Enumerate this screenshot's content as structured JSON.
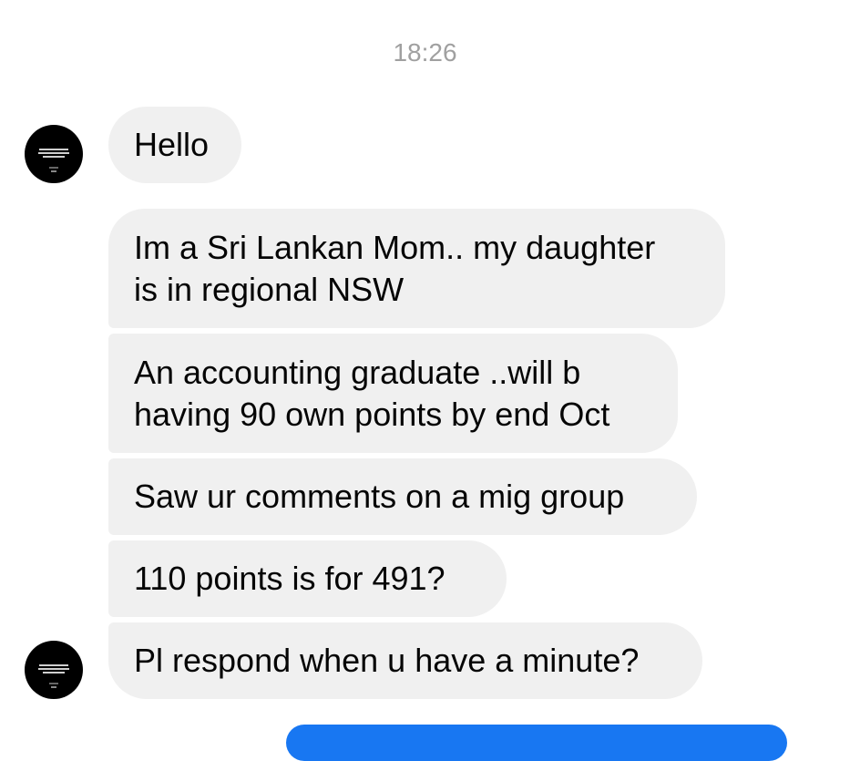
{
  "thread": {
    "timestamp": "18:26",
    "messages": [
      {
        "sender": "contact",
        "text": "Hello",
        "show_avatar": true
      },
      {
        "sender": "contact",
        "text": "Im a Sri Lankan Mom.. my daughter\nis in regional NSW",
        "show_avatar": false
      },
      {
        "sender": "contact",
        "text": "An accounting graduate ..will b\nhaving 90 own points by end Oct",
        "show_avatar": false
      },
      {
        "sender": "contact",
        "text": "Saw ur comments on a mig group",
        "show_avatar": false
      },
      {
        "sender": "contact",
        "text": "110 points is for 491?",
        "show_avatar": false
      },
      {
        "sender": "contact",
        "text": "Pl respond when u have a minute?",
        "show_avatar": true
      }
    ]
  },
  "colors": {
    "incoming_bubble": "#f0f0f0",
    "outgoing_bubble": "#1877f2",
    "timestamp_text": "#a0a0a0",
    "avatar_bg": "#000000"
  },
  "icons": {
    "avatar": "profile-picture"
  }
}
